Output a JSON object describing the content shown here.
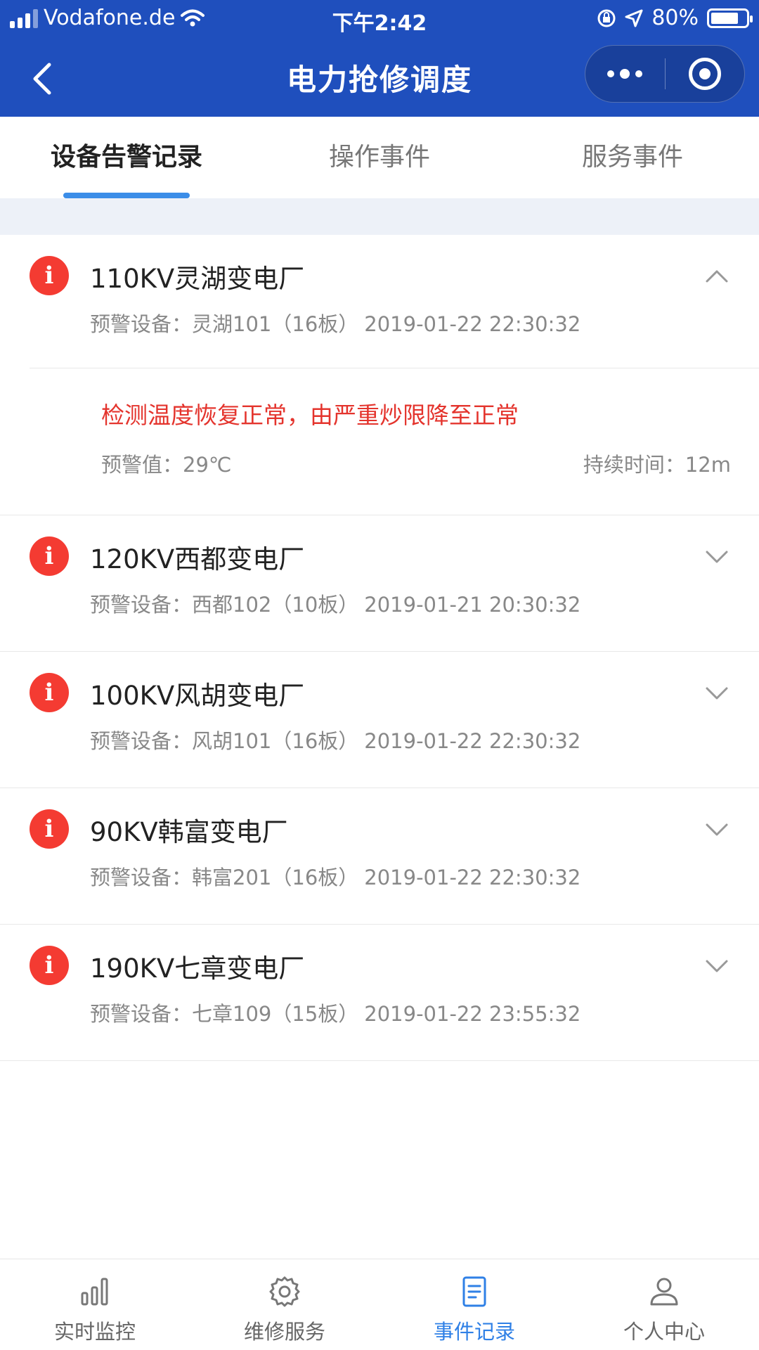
{
  "status_bar": {
    "carrier": "Vodafone.de",
    "time": "下午2:42",
    "battery": "80%",
    "battery_level": 0.8,
    "icons": [
      "signal-icon",
      "wifi-icon",
      "rotation-lock-icon",
      "location-icon",
      "battery-icon"
    ]
  },
  "nav": {
    "title": "电力抢修调度",
    "icons": [
      "back-icon",
      "more-icon",
      "close-target-icon"
    ]
  },
  "tabs": [
    {
      "label": "设备告警记录",
      "active": true
    },
    {
      "label": "操作事件",
      "active": false
    },
    {
      "label": "服务事件",
      "active": false
    }
  ],
  "alerts": {
    "device_prefix": "预警设备：",
    "items": [
      {
        "station": "110KV灵湖变电厂",
        "device": "灵湖101（16板）",
        "time": "2019-01-22 22:30:32",
        "expanded": true,
        "detail": {
          "message": "检测温度恢复正常，由严重炒限降至正常",
          "value_label": "预警值：",
          "value": "29℃",
          "duration_label": "持续时间：",
          "duration": "12m"
        }
      },
      {
        "station": "120KV西都变电厂",
        "device": "西都102（10板）",
        "time": "2019-01-21 20:30:32",
        "expanded": false
      },
      {
        "station": "100KV风胡变电厂",
        "device": "风胡101（16板）",
        "time": "2019-01-22 22:30:32",
        "expanded": false
      },
      {
        "station": "90KV韩富变电厂",
        "device": "韩富201（16板）",
        "time": "2019-01-22 22:30:32",
        "expanded": false
      },
      {
        "station": "190KV七章变电厂",
        "device": "七章109（15板）",
        "time": "2019-01-22 23:55:32",
        "expanded": false
      }
    ]
  },
  "tabbar": [
    {
      "label": "实时监控",
      "icon": "bar-chart-icon",
      "active": false
    },
    {
      "label": "维修服务",
      "icon": "gear-icon",
      "active": false
    },
    {
      "label": "事件记录",
      "icon": "document-icon",
      "active": true
    },
    {
      "label": "个人中心",
      "icon": "user-icon",
      "active": false
    }
  ],
  "colors": {
    "header": "#1f4fbd",
    "accent": "#2f80e6",
    "alert": "#f43b32",
    "message": "#e4342d"
  }
}
